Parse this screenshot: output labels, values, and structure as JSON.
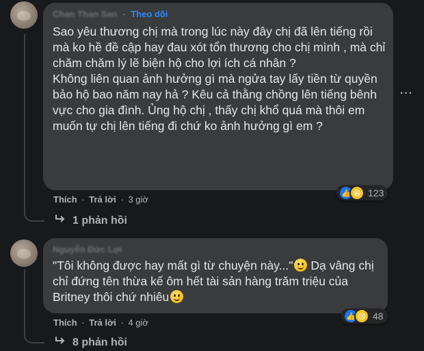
{
  "comments": [
    {
      "author": "Chan Than San",
      "follow_label": "Theo dõi",
      "paragraphs": [
        "Sao yêu thương chị mà trong lúc này đây chị đã lên tiếng rồi mà ko hề đề cập hay đau xót tổn thương cho chị mình , mà chỉ chăm chăm lý lẽ biện hộ cho lợi ích cá nhân ?",
        "Không liên quan ảnh hưởng gì mà ngửa tay lấy tiền từ quyền bảo hộ bao năm nay hả ? Kêu cả thằng chồng lên tiếng bênh vực cho gia đình. Ủng hộ chị , thấy chị khổ quá mà thôi em muốn tự chị lên tiếng đi chứ ko ảnh hưởng gì em ?"
      ],
      "reaction_count": "123",
      "reaction_icons": [
        "like-icon",
        "haha-icon"
      ],
      "like_label": "Thích",
      "reply_label": "Trả lời",
      "time": "3 giờ",
      "replies_label": "1 phản hồi"
    },
    {
      "author": "Nguyễn Đức Lợi",
      "text_part1": "\"Tôi không được hay mất gì từ chuyện này...\"",
      "text_part2": " Dạ vâng chị chỉ đứng tên thừa kế ôm hết tài sản hàng trăm triệu của Britney thôi chứ nhiêu",
      "reaction_count": "48",
      "reaction_icons": [
        "like-icon",
        "sad-icon"
      ],
      "like_label": "Thích",
      "reply_label": "Trả lời",
      "time": "4 giờ",
      "replies_label": "8 phản hồi"
    }
  ],
  "more_options": "···",
  "separator": "·",
  "colors": {
    "bubble": "#3a3b3c",
    "background": "#18191a",
    "link": "#2d88ff",
    "like": "#1877f2"
  }
}
